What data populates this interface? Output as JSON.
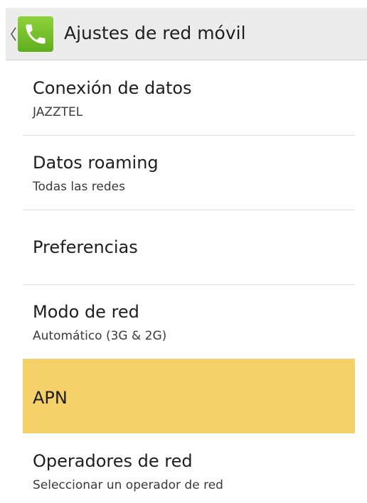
{
  "action_bar": {
    "title": "Ajustes de red móvil",
    "app_icon": "phone-icon",
    "back_icon": "chevron-left-icon",
    "icon_color": "#6cbf26"
  },
  "items": [
    {
      "title": "Conexión de datos",
      "summary": "JAZZTEL"
    },
    {
      "title": "Datos roaming",
      "summary": "Todas las redes"
    },
    {
      "title": "Preferencias",
      "summary": ""
    },
    {
      "title": "Modo de red",
      "summary": "Automático (3G & 2G)"
    },
    {
      "title": "APN",
      "summary": "",
      "selected": true
    },
    {
      "title": "Operadores de red",
      "summary": "Seleccionar un operador de red"
    }
  ],
  "colors": {
    "selected_background": "#f6d068",
    "action_bar_background": "#ececec"
  }
}
